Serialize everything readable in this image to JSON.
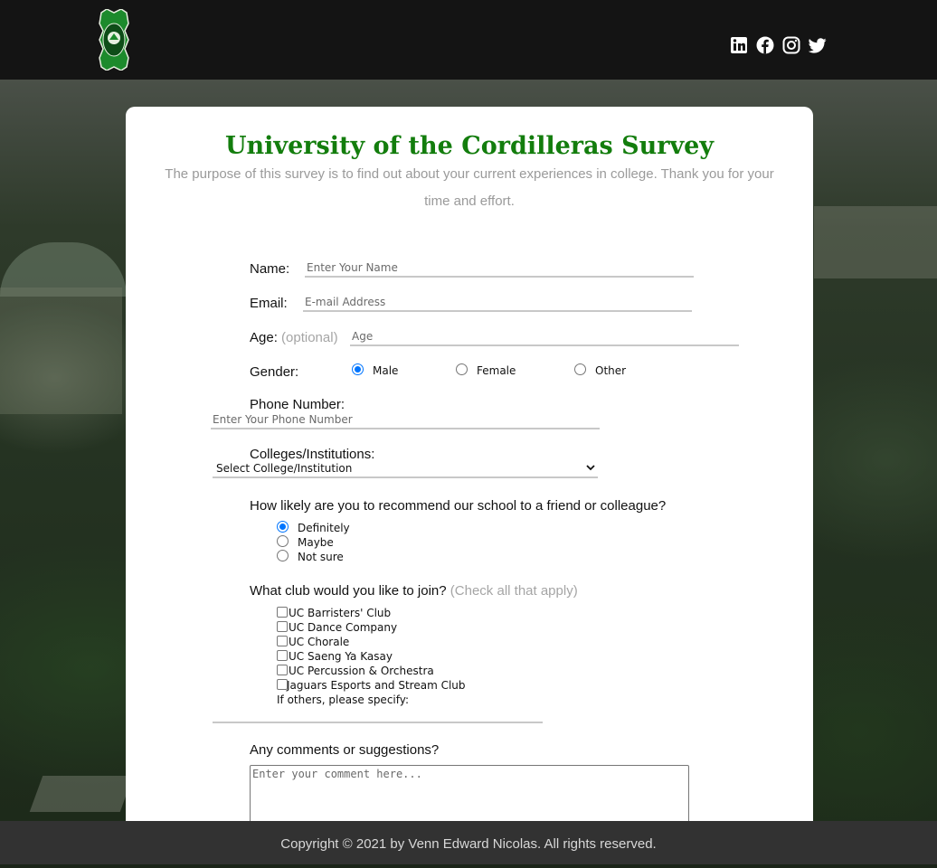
{
  "header": {
    "social": [
      "linkedin-icon",
      "facebook-icon",
      "instagram-icon",
      "twitter-icon"
    ]
  },
  "survey": {
    "title": "University of the Cordilleras Survey",
    "description": "The purpose of this survey is to find out about your current experiences in college. Thank you for your time and effort.",
    "name_label": "Name:",
    "name_placeholder": "Enter Your Name",
    "email_label": "Email:",
    "email_placeholder": "E-mail Address",
    "age_label": "Age:",
    "age_optional": "(optional)",
    "age_placeholder": "Age",
    "gender_label": "Gender:",
    "gender_options": [
      "Male",
      "Female",
      "Other"
    ],
    "gender_selected": "Male",
    "phone_label": "Phone Number:",
    "phone_placeholder": "Enter Your Phone Number",
    "college_label": "Colleges/Institutions:",
    "college_selected": "Select College/Institution",
    "recommend_question": "How likely are you to recommend our school to a friend or colleague?",
    "recommend_options": [
      "Definitely",
      "Maybe",
      "Not sure"
    ],
    "recommend_selected": "Definitely",
    "club_question": "What club would you like to join?",
    "club_hint": "(Check all that apply)",
    "clubs": [
      "UC Barristers' Club",
      "UC Dance Company",
      "UC Chorale",
      "UC Saeng Ya Kasay",
      "UC Percussion & Orchestra",
      "Jaguars Esports and Stream Club"
    ],
    "others_label": "If others, please specify:",
    "comments_label": "Any comments or suggestions?",
    "comments_placeholder": "Enter your comment here..."
  },
  "footer": {
    "copyright": "Copyright © 2021 by Venn Edward Nicolas. All rights reserved."
  },
  "colors": {
    "title_green": "#137d0d",
    "topbar": "#141414",
    "footer": "#323232",
    "radio_accent": "#0075ff"
  }
}
